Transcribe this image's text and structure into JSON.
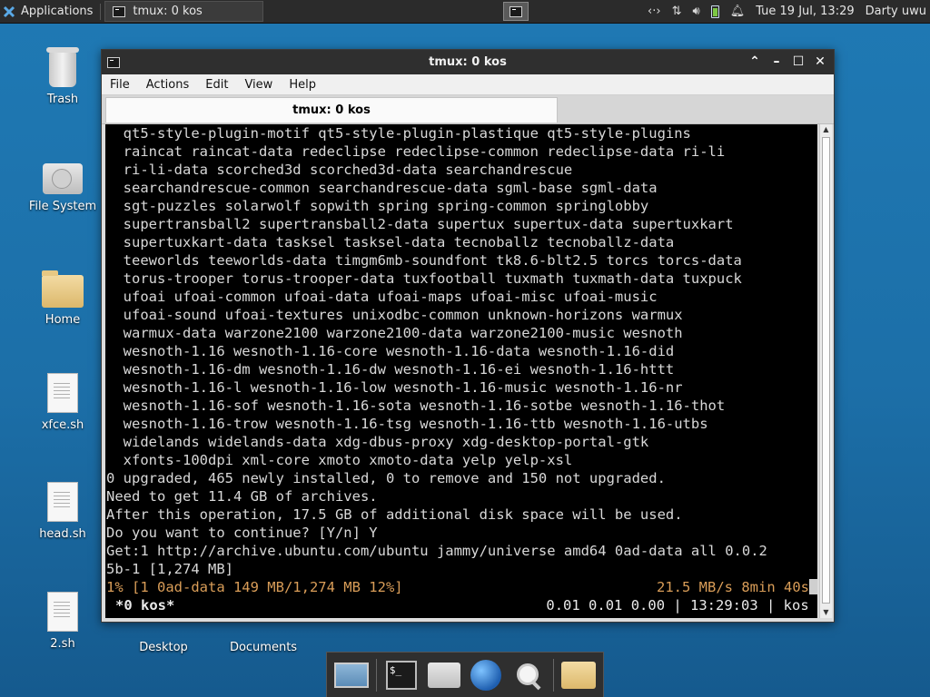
{
  "panel": {
    "applications_label": "Applications",
    "task_label": "tmux: 0 kos",
    "clock": "Tue 19 Jul, 13:29",
    "user": "Darty uwu"
  },
  "desktop": {
    "icons": [
      {
        "label": "Trash",
        "icon": "trash-icon"
      },
      {
        "label": "File System",
        "icon": "drive-icon"
      },
      {
        "label": "Home",
        "icon": "home-folder-icon"
      },
      {
        "label": "xfce.sh",
        "icon": "script-file-icon"
      },
      {
        "label": "head.sh",
        "icon": "script-file-icon"
      },
      {
        "label": "2.sh",
        "icon": "locked-script-file-icon"
      },
      {
        "label": "Desktop",
        "icon": "folder-icon"
      },
      {
        "label": "Documents",
        "icon": "folder-icon"
      }
    ]
  },
  "window": {
    "title": "tmux: 0 kos",
    "menu": [
      "File",
      "Actions",
      "Edit",
      "View",
      "Help"
    ],
    "tab_label": "tmux: 0 kos"
  },
  "terminal": {
    "lines": [
      "  qt5-style-plugin-motif qt5-style-plugin-plastique qt5-style-plugins",
      "  raincat raincat-data redeclipse redeclipse-common redeclipse-data ri-li",
      "  ri-li-data scorched3d scorched3d-data searchandrescue",
      "  searchandrescue-common searchandrescue-data sgml-base sgml-data",
      "  sgt-puzzles solarwolf sopwith spring spring-common springlobby",
      "  supertransball2 supertransball2-data supertux supertux-data supertuxkart",
      "  supertuxkart-data tasksel tasksel-data tecnoballz tecnoballz-data",
      "  teeworlds teeworlds-data timgm6mb-soundfont tk8.6-blt2.5 torcs torcs-data",
      "  torus-trooper torus-trooper-data tuxfootball tuxmath tuxmath-data tuxpuck",
      "  ufoai ufoai-common ufoai-data ufoai-maps ufoai-misc ufoai-music",
      "  ufoai-sound ufoai-textures unixodbc-common unknown-horizons warmux",
      "  warmux-data warzone2100 warzone2100-data warzone2100-music wesnoth",
      "  wesnoth-1.16 wesnoth-1.16-core wesnoth-1.16-data wesnoth-1.16-did",
      "  wesnoth-1.16-dm wesnoth-1.16-dw wesnoth-1.16-ei wesnoth-1.16-httt",
      "  wesnoth-1.16-l wesnoth-1.16-low wesnoth-1.16-music wesnoth-1.16-nr",
      "  wesnoth-1.16-sof wesnoth-1.16-sota wesnoth-1.16-sotbe wesnoth-1.16-thot",
      "  wesnoth-1.16-trow wesnoth-1.16-tsg wesnoth-1.16-ttb wesnoth-1.16-utbs",
      "  widelands widelands-data xdg-dbus-proxy xdg-desktop-portal-gtk",
      "  xfonts-100dpi xml-core xmoto xmoto-data yelp yelp-xsl",
      "0 upgraded, 465 newly installed, 0 to remove and 150 not upgraded.",
      "Need to get 11.4 GB of archives.",
      "After this operation, 17.5 GB of additional disk space will be used.",
      "Do you want to continue? [Y/n] Y",
      "Get:1 http://archive.ubuntu.com/ubuntu jammy/universe amd64 0ad-data all 0.0.2",
      "5b-1 [1,274 MB]"
    ],
    "progress_left": "1% [1 0ad-data 149 MB/1,274 MB 12%]",
    "progress_right": "21.5 MB/s 8min 40s",
    "status_left": "*0 kos*",
    "status_right": "0.01 0.01 0.00 | 13:29:03 | kos "
  }
}
